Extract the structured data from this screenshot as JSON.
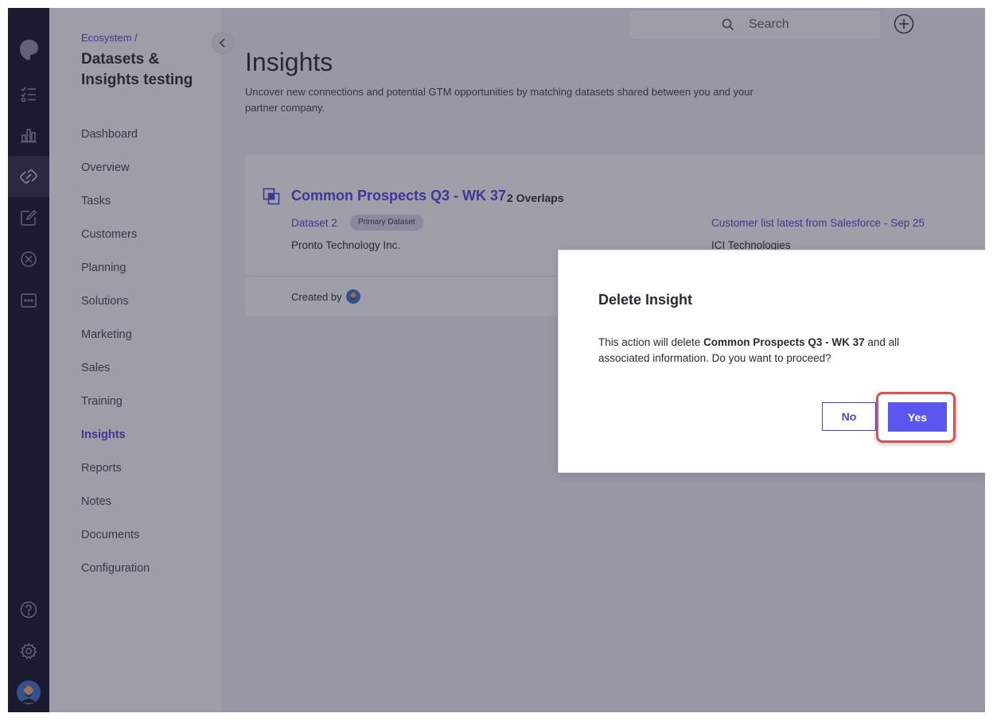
{
  "sidebar": {
    "breadcrumb": "Ecosystem /",
    "project_title": "Datasets & Insights testing",
    "nav_items": [
      {
        "label": "Dashboard"
      },
      {
        "label": "Overview"
      },
      {
        "label": "Tasks"
      },
      {
        "label": "Customers"
      },
      {
        "label": "Planning"
      },
      {
        "label": "Solutions"
      },
      {
        "label": "Marketing"
      },
      {
        "label": "Sales"
      },
      {
        "label": "Training"
      },
      {
        "label": "Insights",
        "active": true
      },
      {
        "label": "Reports"
      },
      {
        "label": "Notes"
      },
      {
        "label": "Documents"
      },
      {
        "label": "Configuration"
      }
    ]
  },
  "rail_icons": [
    "logo-icon",
    "checklist-icon",
    "chart-icon",
    "partnership-icon",
    "edit-icon",
    "compass-icon",
    "chat-icon",
    "help-icon",
    "settings-icon",
    "user-avatar"
  ],
  "header": {
    "search_placeholder": "Search"
  },
  "page": {
    "title": "Insights",
    "description": "Uncover new connections and potential GTM opportunities by matching datasets shared between you and your partner company."
  },
  "insight_card": {
    "name": "Common Prospects Q3 - WK 37",
    "overlaps": "2 Overlaps",
    "left_dataset": "Dataset 2",
    "left_badge": "Primary Dataset",
    "left_company": "Pronto Technology Inc.",
    "right_dataset": "Customer list latest from Salesforce - Sep 25",
    "right_company": "ICI Technologies",
    "created_by_label": "Created by"
  },
  "modal": {
    "title": "Delete Insight",
    "body_prefix": "This action will delete ",
    "body_bold": "Common Prospects Q3 - WK 37",
    "body_suffix": " and all associated information. Do you want to proceed?",
    "no_label": "No",
    "yes_label": "Yes"
  },
  "colors": {
    "accent": "#4b46d6",
    "primary_button": "#5c56f0",
    "rail_bg": "#121128",
    "highlight": "#d9534f"
  }
}
